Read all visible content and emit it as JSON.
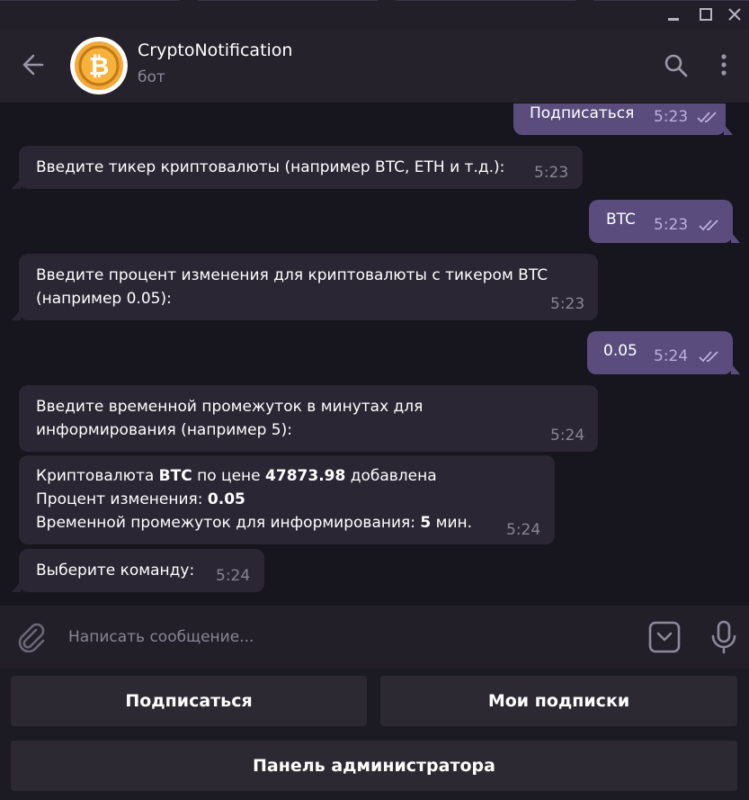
{
  "header": {
    "name": "CryptoNotification",
    "status": "бот",
    "avatar_icon": "bitcoin-icon"
  },
  "messages": [
    {
      "dir": "out",
      "text": "Подписаться",
      "time": "5:23",
      "read": true
    },
    {
      "dir": "in",
      "text": "Введите тикер криптовалюты (например BTC, ETH и т.д.):",
      "time": "5:23"
    },
    {
      "dir": "out",
      "text": "BTC",
      "time": "5:23",
      "read": true
    },
    {
      "dir": "in",
      "lines": [
        "Введите процент изменения для криптовалюты с тикером BTC",
        "(например 0.05):"
      ],
      "time": "5:23"
    },
    {
      "dir": "out",
      "text": "0.05",
      "time": "5:24",
      "read": true
    },
    {
      "dir": "in",
      "lines": [
        "Введите временной промежуток в минутах для",
        "информирования (например 5):"
      ],
      "time": "5:24"
    },
    {
      "dir": "in",
      "parts": {
        "l1_a": "Криптовалюта ",
        "l1_b": "BTC",
        "l1_c": " по цене ",
        "l1_d": "47873.98",
        "l1_e": " добавлена",
        "l2_a": "Процент изменения: ",
        "l2_b": "0.05",
        "l3_a": "Временной промежуток для информирования: ",
        "l3_b": "5",
        "l3_c": " мин."
      },
      "time": "5:24"
    },
    {
      "dir": "in",
      "text": "Выберите команду:",
      "time": "5:24"
    }
  ],
  "composer": {
    "placeholder": "Написать сообщение..."
  },
  "keyboard": {
    "row1": [
      "Подписаться",
      "Мои подписки"
    ],
    "row2": [
      "Панель администратора"
    ]
  },
  "colors": {
    "background": "#17151d",
    "incoming_bubble": "#2a2633",
    "outgoing_bubble": "#5a4d7d",
    "header": "#25222b",
    "keyboard_button": "#2c2933"
  }
}
